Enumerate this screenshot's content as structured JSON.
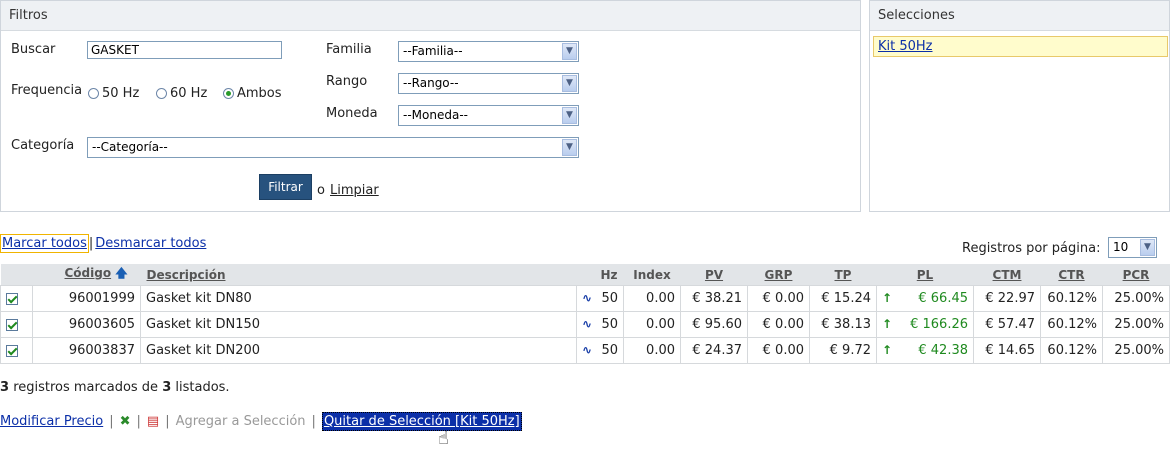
{
  "filters": {
    "title": "Filtros",
    "buscar_label": "Buscar",
    "buscar_value": "GASKET",
    "frequencia_label": "Frequencia",
    "freq_options": [
      "50 Hz",
      "60 Hz",
      "Ambos"
    ],
    "freq_selected": "Ambos",
    "familia_label": "Familia",
    "familia_value": "--Familia--",
    "rango_label": "Rango",
    "rango_value": "--Rango--",
    "moneda_label": "Moneda",
    "moneda_value": "--Moneda--",
    "categoria_label": "Categoría",
    "categoria_value": "--Categoría--",
    "filtrar_label": "Filtrar",
    "or_text": "o",
    "limpiar_label": "Limpiar"
  },
  "selections": {
    "title": "Selecciones",
    "item": "Kit 50Hz"
  },
  "toolbar": {
    "marcar_todos": "Marcar todos",
    "separator": "|",
    "desmarcar_todos": "Desmarcar todos",
    "registros_label": "Registros por página:",
    "registros_value": "10"
  },
  "table": {
    "headers": {
      "codigo": "Código",
      "descripcion": "Descripción",
      "hz": "Hz",
      "index": "Index",
      "pv": "PV",
      "grp": "GRP",
      "tp": "TP",
      "pl": "PL",
      "ctm": "CTM",
      "ctr": "CTR",
      "pcr": "PCR"
    },
    "rows": [
      {
        "codigo": "96001999",
        "descripcion": "Gasket kit DN80",
        "hz": "50",
        "index": "0.00",
        "pv": "€ 38.21",
        "grp": "€ 0.00",
        "tp": "€ 15.24",
        "pl": "€ 66.45",
        "ctm": "€ 22.97",
        "ctr": "60.12%",
        "pcr": "25.00%"
      },
      {
        "codigo": "96003605",
        "descripcion": "Gasket kit DN150",
        "hz": "50",
        "index": "0.00",
        "pv": "€ 95.60",
        "grp": "€ 0.00",
        "tp": "€ 38.13",
        "pl": "€ 166.26",
        "ctm": "€ 57.47",
        "ctr": "60.12%",
        "pcr": "25.00%"
      },
      {
        "codigo": "96003837",
        "descripcion": "Gasket kit DN200",
        "hz": "50",
        "index": "0.00",
        "pv": "€ 24.37",
        "grp": "€ 0.00",
        "tp": "€ 9.72",
        "pl": "€ 42.38",
        "ctm": "€ 14.65",
        "ctr": "60.12%",
        "pcr": "25.00%"
      }
    ]
  },
  "summary": {
    "marked": "3",
    "text1": "registros marcados de",
    "listed": "3",
    "text2": "listados."
  },
  "actions": {
    "modificar_precio": "Modificar Precio",
    "separator": "|",
    "agregar": "Agregar a Selección",
    "quitar": "Quitar de Selección [Kit 50Hz]"
  }
}
